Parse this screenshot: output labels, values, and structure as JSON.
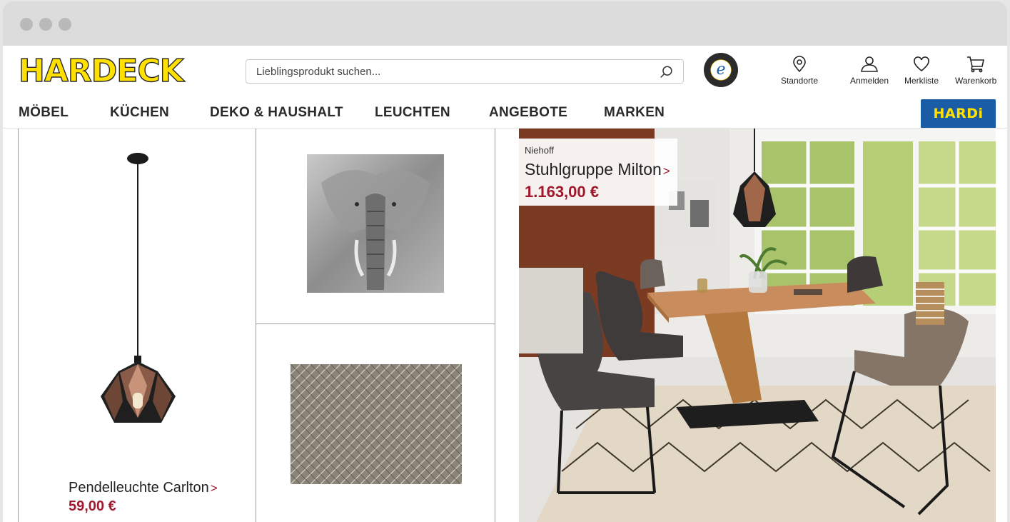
{
  "site": {
    "logo_text": "HARDECK",
    "search_placeholder": "Lieblingsprodukt suchen...",
    "header_icons": [
      {
        "icon": "location-pin-icon",
        "label": "Standorte"
      },
      {
        "icon": "user-icon",
        "label": "Anmelden"
      },
      {
        "icon": "heart-icon",
        "label": "Merkliste"
      },
      {
        "icon": "cart-icon",
        "label": "Warenkorb"
      }
    ],
    "nav": [
      "MÖBEL",
      "KÜCHEN",
      "DEKO & HAUSHALT",
      "LEUCHTEN",
      "ANGEBOTE",
      "MARKEN"
    ],
    "hardi_label": "HARDi",
    "trusted_badge": "e"
  },
  "products": [
    {
      "name": "Pendelleuchte Carlton",
      "arrow": ">",
      "price": "59,00 €"
    },
    {
      "brand": "Niehoff",
      "name": "Stuhlgruppe Milton",
      "arrow": ">",
      "price": "1.163,00 €"
    }
  ],
  "colors": {
    "accent_price": "#a0182e",
    "logo_yellow": "#ffe000",
    "hardi_blue": "#1a5ca5"
  }
}
